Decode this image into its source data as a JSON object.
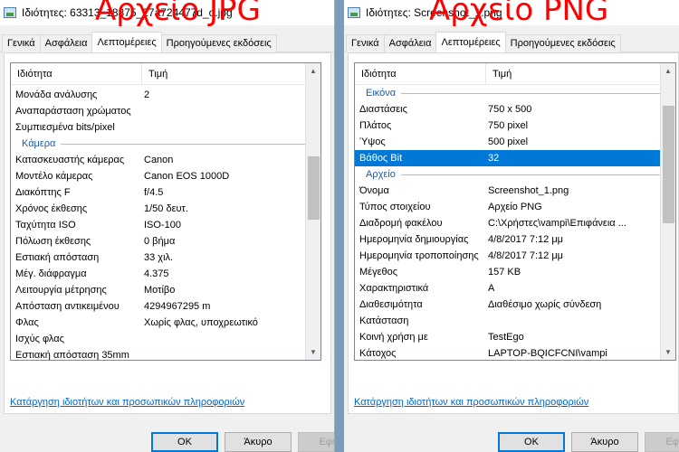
{
  "left": {
    "title": "Ιδιότητες: 63313_18875_27a724477d_o.jpg",
    "overlay": "Αρχείο JPG",
    "tabs": [
      "Γενικά",
      "Ασφάλεια",
      "Λεπτομέρειες",
      "Προηγούμενες εκδόσεις"
    ],
    "header": {
      "property": "Ιδιότητα",
      "value": "Τιμή"
    },
    "rows_top": [
      {
        "p": "Μονάδα ανάλυσης",
        "v": "2"
      },
      {
        "p": "Αναπαράσταση χρώματος",
        "v": ""
      },
      {
        "p": "Συμπιεσμένα bits/pixel",
        "v": ""
      }
    ],
    "group1": "Κάμερα",
    "rows_camera": [
      {
        "p": "Κατασκευαστής κάμερας",
        "v": "Canon"
      },
      {
        "p": "Μοντέλο κάμερας",
        "v": "Canon EOS 1000D"
      },
      {
        "p": "Διακόπτης F",
        "v": "f/4.5"
      },
      {
        "p": "Χρόνος έκθεσης",
        "v": "1/50 δευτ."
      },
      {
        "p": "Ταχύτητα ISO",
        "v": "ISO-100"
      },
      {
        "p": "Πόλωση έκθεσης",
        "v": "0 βήμα"
      },
      {
        "p": "Εστιακή απόσταση",
        "v": "33 χιλ."
      },
      {
        "p": "Μέγ. διάφραγμα",
        "v": "4.375"
      },
      {
        "p": "Λειτουργία μέτρησης",
        "v": "Μοτίβο"
      },
      {
        "p": "Απόσταση αντικειμένου",
        "v": "4294967295 m"
      },
      {
        "p": "Φλας",
        "v": "Χωρίς φλας, υποχρεωτικό"
      },
      {
        "p": "Ισχύς φλας",
        "v": ""
      },
      {
        "p": "Εστιακή απόσταση 35mm",
        "v": ""
      }
    ],
    "link": "Κατάργηση ιδιοτήτων και προσωπικών πληροφοριών",
    "buttons": {
      "ok": "OK",
      "cancel": "Άκυρο",
      "apply": "Εφαρ"
    },
    "scroll_position": 0.38
  },
  "right": {
    "title": "Ιδιότητες: Screenshot_1.png",
    "overlay": "Αρχείο PNG",
    "tabs": [
      "Γενικά",
      "Ασφάλεια",
      "Λεπτομέρειες",
      "Προηγούμενες εκδόσεις"
    ],
    "header": {
      "property": "Ιδιότητα",
      "value": "Τιμή"
    },
    "group1": "Εικόνα",
    "rows_image": [
      {
        "p": "Διαστάσεις",
        "v": "750 x 500"
      },
      {
        "p": "Πλάτος",
        "v": "750 pixel"
      },
      {
        "p": "Ύψος",
        "v": "500 pixel"
      },
      {
        "p": "Βάθος Bit",
        "v": "32"
      }
    ],
    "group2": "Αρχείο",
    "rows_file": [
      {
        "p": "Όνομα",
        "v": "Screenshot_1.png"
      },
      {
        "p": "Τύπος στοιχείου",
        "v": "Αρχείο PNG"
      },
      {
        "p": "Διαδρομή φακέλου",
        "v": "C:\\Χρήστες\\vampi\\Επιφάνεια ..."
      },
      {
        "p": "Ημερομηνία δημιουργίας",
        "v": "4/8/2017 7:12 μμ"
      },
      {
        "p": "Ημερομηνία τροποποίησης",
        "v": "4/8/2017 7:12 μμ"
      },
      {
        "p": "Μέγεθος",
        "v": "157 KB"
      },
      {
        "p": "Χαρακτηριστικά",
        "v": "A"
      },
      {
        "p": "Διαθεσιμότητα",
        "v": "Διαθέσιμο χωρίς σύνδεση"
      },
      {
        "p": "Κατάσταση",
        "v": ""
      },
      {
        "p": "Κοινή χρήση με",
        "v": "TestEgo"
      },
      {
        "p": "Κάτοχος",
        "v": "LAPTOP-BQICFCNI\\vampi"
      }
    ],
    "link": "Κατάργηση ιδιοτήτων και προσωπικών πληροφοριών",
    "buttons": {
      "ok": "OK",
      "cancel": "Άκυρο",
      "apply": "Εφαρ"
    },
    "scroll_position": 0.0
  },
  "colors": {
    "accent": "#0078d7",
    "overlay": "#ff0000",
    "group": "#1e5aa8",
    "link": "#0066cc"
  }
}
